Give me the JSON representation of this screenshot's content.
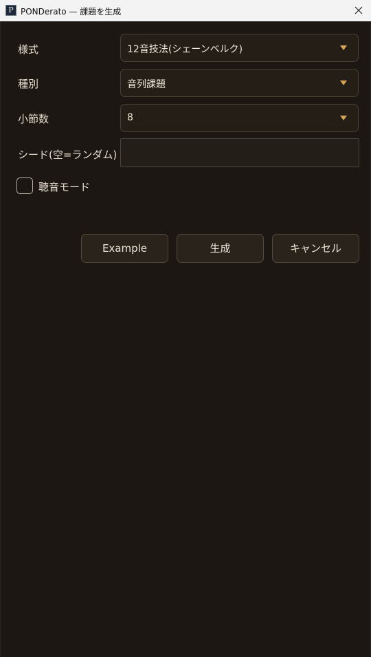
{
  "window": {
    "title": "PONDerato — 課題を生成",
    "app_icon": "pond-app-icon",
    "close_icon": "close-icon"
  },
  "form": {
    "style": {
      "label": "様式",
      "value": "12音技法(シェーンベルク)"
    },
    "kind": {
      "label": "種別",
      "value": "音列課題"
    },
    "measures": {
      "label": "小節数",
      "value": "8"
    },
    "seed": {
      "label": "シード(空=ランダム)",
      "value": "",
      "placeholder": ""
    },
    "ear_mode": {
      "label": "聴音モード",
      "checked": false
    }
  },
  "buttons": {
    "example": "Example",
    "generate": "生成",
    "cancel": "キャンセル"
  },
  "colors": {
    "background": "#1c1712",
    "control": "#241e17",
    "border": "#4a4033",
    "accent_arrow": "#d7a35a",
    "text": "#e9e1d3"
  }
}
